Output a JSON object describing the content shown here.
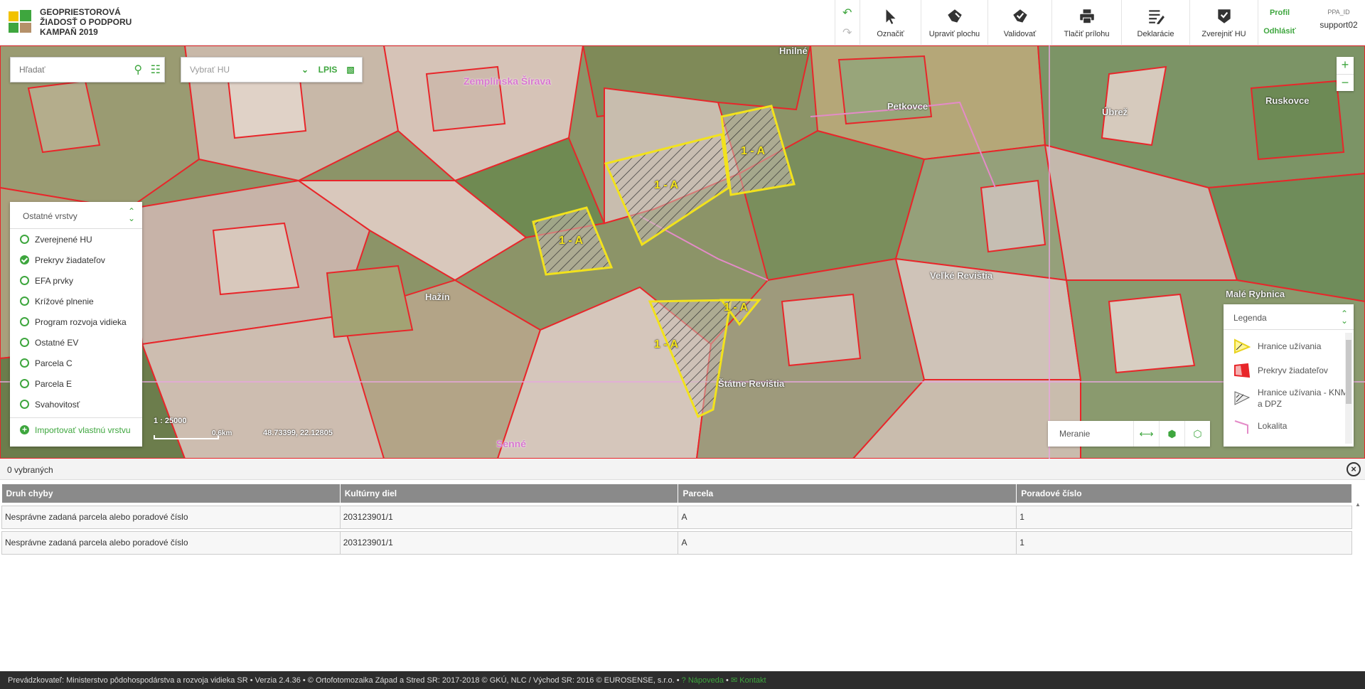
{
  "app": {
    "title_lines": [
      "GEOPRIESTOROVÁ",
      "ŽIADOSŤ O PODPORU",
      "KAMPAŇ 2019"
    ]
  },
  "toolbar": {
    "undo_icon": "undo-icon",
    "redo_icon": "redo-icon",
    "tools": [
      {
        "label": "Označiť",
        "icon": "cursor-icon"
      },
      {
        "label": "Upraviť plochu",
        "icon": "edit-polygon-icon"
      },
      {
        "label": "Validovať",
        "icon": "validate-icon"
      },
      {
        "label": "Tlačiť prílohu",
        "icon": "print-icon"
      },
      {
        "label": "Deklarácie",
        "icon": "declarations-icon"
      },
      {
        "label": "Zverejniť HU",
        "icon": "publish-icon"
      }
    ],
    "profile_label": "Profil",
    "logout_label": "Odhlásiť",
    "ppa_id_label": "PPA_ID",
    "username": "support02"
  },
  "search": {
    "placeholder": "Hľadať"
  },
  "hu_select": {
    "placeholder": "Vybrať HU",
    "lpis_label": "LPIS"
  },
  "map": {
    "labels": [
      "Zemplínska Šírava",
      "Veľké Revištia",
      "Senné",
      "Hažín",
      "Ruskovce",
      "Úbrež",
      "Petkovce",
      "Hnilné",
      "Štátne Revištia",
      "Malé Rybnica"
    ],
    "parcel_labels": [
      "1 - A",
      "1 - A",
      "1 - A",
      "1 - A",
      "1 - A"
    ],
    "scale": "1 : 25000",
    "scale_distance": "0.6km",
    "coordinates": "48.73399, 22.12805"
  },
  "layers": {
    "title": "Ostatné vrstvy",
    "items": [
      {
        "label": "Zverejnené HU",
        "checked": false
      },
      {
        "label": "Prekryv žiadateľov",
        "checked": true
      },
      {
        "label": "EFA prvky",
        "checked": false
      },
      {
        "label": "Krížové plnenie",
        "checked": false
      },
      {
        "label": "Program rozvoja vidieka",
        "checked": false
      },
      {
        "label": "Ostatné EV",
        "checked": false
      },
      {
        "label": "Parcela C",
        "checked": false
      },
      {
        "label": "Parcela E",
        "checked": false
      },
      {
        "label": "Svahovitosť",
        "checked": false
      }
    ],
    "import_label": "Importovať vlastnú vrstvu"
  },
  "legend": {
    "title": "Legenda",
    "items": [
      {
        "label": "Hranice užívania"
      },
      {
        "label": "Prekryv žiadateľov"
      },
      {
        "label": "Hranice užívania - KNM a DPZ"
      },
      {
        "label": "Lokalita"
      }
    ]
  },
  "measure": {
    "label": "Meranie"
  },
  "results": {
    "selected_count_text": "0 vybraných",
    "columns": [
      "Druh chyby",
      "Kultúrny diel",
      "Parcela",
      "Poradové číslo"
    ],
    "rows": [
      [
        "Nesprávne zadaná parcela alebo poradové číslo",
        "203123901/1",
        "A",
        "1"
      ],
      [
        "Nesprávne zadaná parcela alebo poradové číslo",
        "203123901/1",
        "A",
        "1"
      ]
    ]
  },
  "footer": {
    "text": "Prevádzkovateľ: Ministerstvo pôdohospodárstva a rozvoja vidieka SR  •  Verzia 2.4.36  •  © Ortofotomozaika Západ a Stred SR: 2017-2018 © GKÚ, NLC / Východ SR: 2016 © EUROSENSE, s.r.o.  •",
    "help_label": "Nápoveda",
    "contact_label": "Kontakt"
  },
  "colors": {
    "accent": "#3ea63e",
    "parcel_border": "#e8262a",
    "selected_border": "#f2e21c",
    "header_gray": "#8a8a8a"
  }
}
